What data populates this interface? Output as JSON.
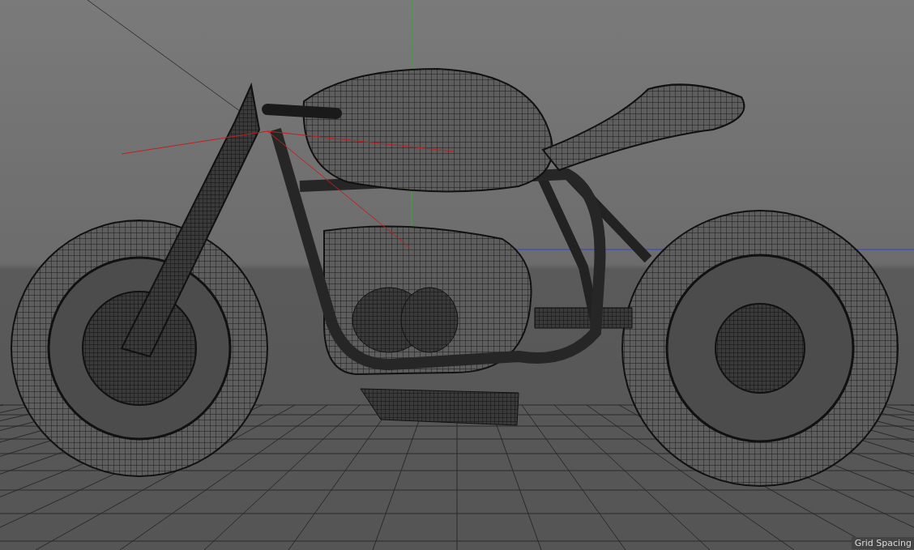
{
  "viewport": {
    "hud_label": "Grid Spacing"
  }
}
